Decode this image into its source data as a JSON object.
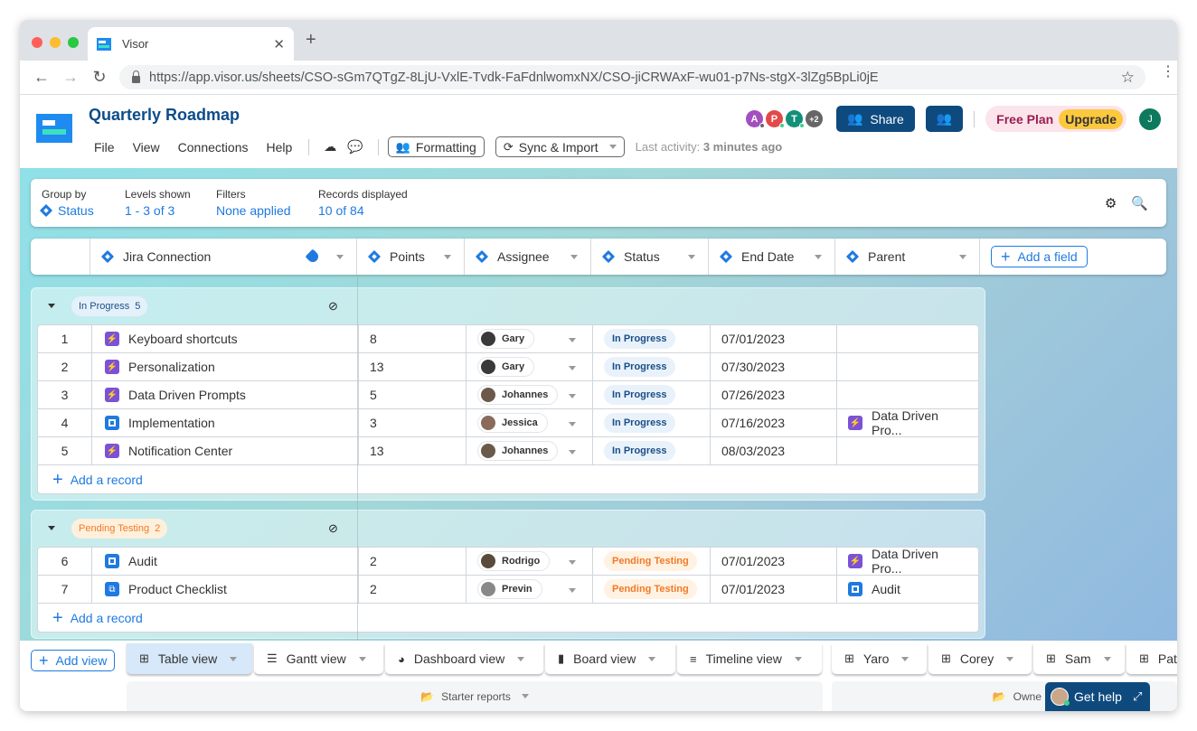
{
  "browser": {
    "tab_title": "Visor",
    "url": "https://app.visor.us/sheets/CSO-sGm7QTgZ-8LjU-VxlE-Tvdk-FaFdnlwomxNX/CSO-jiCRWAxF-wu01-p7Ns-stgX-3lZg5BpLi0jE"
  },
  "header": {
    "title": "Quarterly Roadmap",
    "menus": [
      "File",
      "View",
      "Connections",
      "Help"
    ],
    "formatting_label": "Formatting",
    "sync_label": "Sync & Import",
    "last_activity_label": "Last activity:",
    "last_activity_value": "3 minutes ago",
    "collaborators": [
      {
        "initial": "A",
        "color": "#a34fc0"
      },
      {
        "initial": "P",
        "color": "#e14a4a"
      },
      {
        "initial": "T",
        "color": "#14907a"
      }
    ],
    "more_collaborators": "+2",
    "share_label": "Share",
    "plan_label": "Free Plan",
    "upgrade_label": "Upgrade",
    "user_initial": "J"
  },
  "toolbar": {
    "group_by_label": "Group by",
    "group_by_value": "Status",
    "levels_label": "Levels shown",
    "levels_value": "1 - 3 of 3",
    "filters_label": "Filters",
    "filters_value": "None applied",
    "records_label": "Records displayed",
    "records_value": "10 of 84"
  },
  "columns": [
    "Jira Connection",
    "Points",
    "Assignee",
    "Status",
    "End Date",
    "Parent"
  ],
  "add_field_label": "Add a field",
  "add_record_label": "Add a record",
  "groups": [
    {
      "name": "In Progress",
      "count": "5",
      "rows": [
        {
          "num": "1",
          "type": "epic",
          "name": "Keyboard shortcuts",
          "points": "8",
          "assignee": "Gary",
          "status": "In Progress",
          "end": "07/01/2023",
          "parent": "",
          "parent_type": ""
        },
        {
          "num": "2",
          "type": "epic",
          "name": "Personalization",
          "points": "13",
          "assignee": "Gary",
          "status": "In Progress",
          "end": "07/30/2023",
          "parent": "",
          "parent_type": ""
        },
        {
          "num": "3",
          "type": "epic",
          "name": "Data Driven Prompts",
          "points": "5",
          "assignee": "Johannes",
          "status": "In Progress",
          "end": "07/26/2023",
          "parent": "",
          "parent_type": ""
        },
        {
          "num": "4",
          "type": "task",
          "name": "Implementation",
          "points": "3",
          "assignee": "Jessica",
          "status": "In Progress",
          "end": "07/16/2023",
          "parent": "Data Driven Pro...",
          "parent_type": "epic"
        },
        {
          "num": "5",
          "type": "epic",
          "name": "Notification Center",
          "points": "13",
          "assignee": "Johannes",
          "status": "In Progress",
          "end": "08/03/2023",
          "parent": "",
          "parent_type": ""
        }
      ]
    },
    {
      "name": "Pending Testing",
      "count": "2",
      "rows": [
        {
          "num": "6",
          "type": "task",
          "name": "Audit",
          "points": "2",
          "assignee": "Rodrigo",
          "status": "Pending Testing",
          "end": "07/01/2023",
          "parent": "Data Driven Pro...",
          "parent_type": "epic"
        },
        {
          "num": "7",
          "type": "sub",
          "name": "Product Checklist",
          "points": "2",
          "assignee": "Previn",
          "status": "Pending Testing",
          "end": "07/01/2023",
          "parent": "Audit",
          "parent_type": "task"
        }
      ]
    }
  ],
  "views": {
    "add_view_label": "Add view",
    "tabs": [
      {
        "label": "Table view",
        "icon": "table-icon",
        "active": true
      },
      {
        "label": "Gantt view",
        "icon": "gantt-icon"
      },
      {
        "label": "Dashboard view",
        "icon": "pie-icon"
      },
      {
        "label": "Board view",
        "icon": "board-icon"
      },
      {
        "label": "Timeline view",
        "icon": "timeline-icon"
      },
      {
        "label": "Yaro",
        "icon": "table-icon"
      },
      {
        "label": "Corey",
        "icon": "table-icon"
      },
      {
        "label": "Sam",
        "icon": "table-icon"
      },
      {
        "label": "Pat",
        "icon": "table-icon"
      }
    ],
    "folder1": "Starter reports",
    "folder2": "Owne"
  },
  "help": {
    "label": "Get help"
  }
}
